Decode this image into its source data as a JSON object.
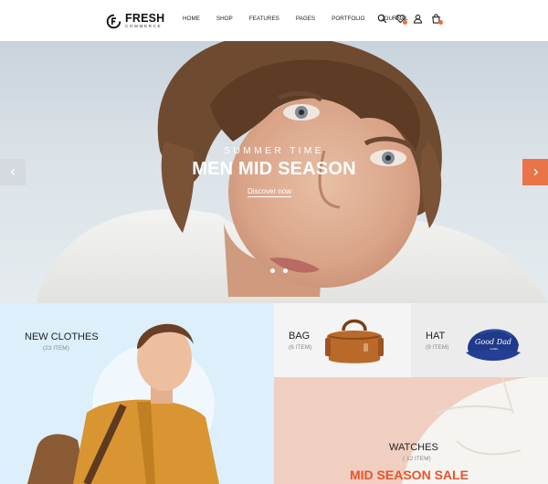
{
  "brand": {
    "name": "FRESH",
    "tagline": "COMMERCE",
    "logo_icon": "logo-mark-icon"
  },
  "nav": {
    "items": [
      "HOME",
      "SHOP",
      "FEATURES",
      "PAGES",
      "PORTFOLIO",
      "JOURNAL"
    ]
  },
  "header_icons": [
    "search-icon",
    "wishlist-icon",
    "user-icon",
    "cart-icon"
  ],
  "hero": {
    "subtitle": "SUMMER TIME",
    "title": "MEN MID SEASON",
    "cta": "Discover now",
    "slide_count": 2,
    "prev_icon": "chevron-left-icon",
    "next_icon": "chevron-right-icon"
  },
  "categories": {
    "clothes": {
      "title": "NEW CLOTHES",
      "count": "(23 ITEM)"
    },
    "bag": {
      "title": "BAG",
      "count": "(6 ITEM)"
    },
    "hat": {
      "title": "HAT",
      "count": "(9 ITEM)",
      "cap_text": "Good Dad",
      "cap_subtext": "GANG"
    },
    "watches": {
      "title": "WATCHES",
      "count": "( 12 ITEM)",
      "sale": "MID SEASON SALE"
    }
  },
  "colors": {
    "accent": "#e9744a",
    "sale": "#e9532a",
    "clothes_bg": "#dceffb",
    "watches_bg": "#f0cfc1"
  }
}
